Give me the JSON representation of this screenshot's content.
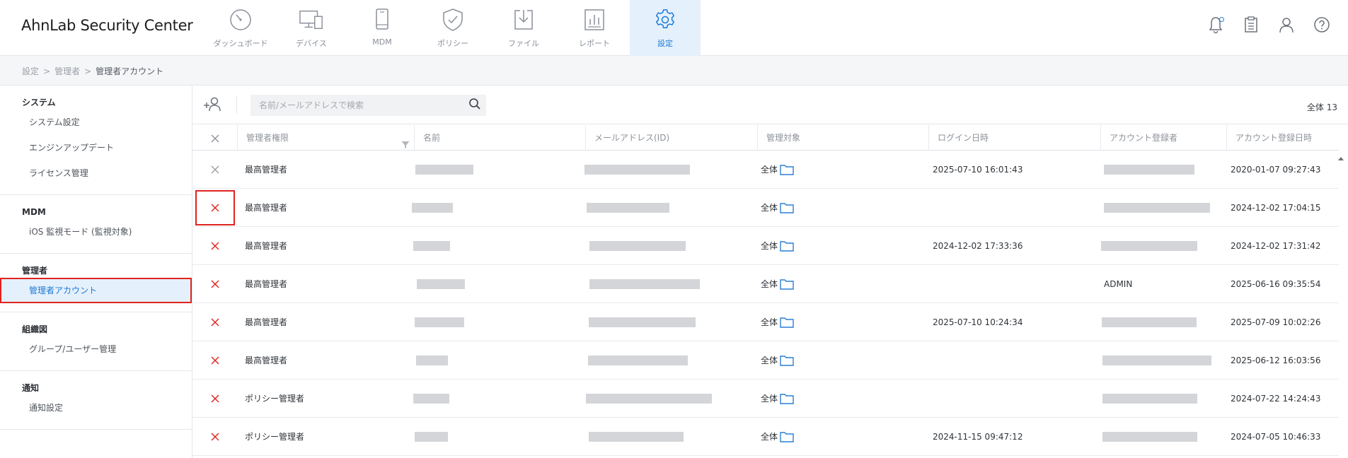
{
  "app": {
    "title": "AhnLab Security Center"
  },
  "nav": [
    {
      "id": "dashboard",
      "label": "ダッシュボード",
      "icon": "dashboard-icon",
      "active": false
    },
    {
      "id": "device",
      "label": "デバイス",
      "icon": "device-icon",
      "active": false
    },
    {
      "id": "mdm",
      "label": "MDM",
      "icon": "mobile-icon",
      "active": false
    },
    {
      "id": "policy",
      "label": "ポリシー",
      "icon": "shield-icon",
      "active": false
    },
    {
      "id": "file",
      "label": "ファイル",
      "icon": "download-icon",
      "active": false
    },
    {
      "id": "report",
      "label": "レポート",
      "icon": "report-icon",
      "active": false
    },
    {
      "id": "settings",
      "label": "設定",
      "icon": "gear-icon",
      "active": true
    }
  ],
  "top_actions": [
    "bell-icon",
    "clipboard-icon",
    "user-icon",
    "help-icon"
  ],
  "breadcrumb": {
    "items": [
      "設定",
      "管理者"
    ],
    "current": "管理者アカウント",
    "separator": ">"
  },
  "sidebar": {
    "groups": [
      {
        "title": "システム",
        "items": [
          {
            "label": "システム設定"
          },
          {
            "label": "エンジンアップデート"
          },
          {
            "label": "ライセンス管理"
          }
        ]
      },
      {
        "title": "MDM",
        "items": [
          {
            "label": "iOS 監視モード (監視対象)"
          }
        ]
      },
      {
        "title": "管理者",
        "items": [
          {
            "label": "管理者アカウント",
            "active": true
          }
        ]
      },
      {
        "title": "組織図",
        "items": [
          {
            "label": "グループ/ユーザー管理"
          }
        ]
      },
      {
        "title": "通知",
        "items": [
          {
            "label": "通知設定"
          }
        ]
      }
    ]
  },
  "toolbar": {
    "search_placeholder": "名前/メールアドレスで検索",
    "total_label": "全体 13"
  },
  "table": {
    "columns": [
      "×",
      "管理者権限",
      "名前",
      "メールアドレス(ID)",
      "管理対象",
      "ログイン日時",
      "アカウント登録者",
      "アカウント登録日時"
    ],
    "rows": [
      {
        "delete_color": "#9aa0a6",
        "role": "最高管理者",
        "target": "全体",
        "login": "2025-07-10 16:01:43",
        "registrar": "",
        "registered": "2020-01-07 09:27:43"
      },
      {
        "delete_color": "#e0231f",
        "highlight": true,
        "role": "最高管理者",
        "target": "全体",
        "login": "",
        "registrar": "",
        "registered": "2024-12-02 17:04:15"
      },
      {
        "delete_color": "#e0231f",
        "role": "最高管理者",
        "target": "全体",
        "login": "2024-12-02 17:33:36",
        "registrar": "",
        "registered": "2024-12-02 17:31:42"
      },
      {
        "delete_color": "#e0231f",
        "role": "最高管理者",
        "target": "全体",
        "login": "",
        "registrar": "ADMIN",
        "registered": "2025-06-16 09:35:54"
      },
      {
        "delete_color": "#e0231f",
        "role": "最高管理者",
        "target": "全体",
        "login": "2025-07-10 10:24:34",
        "registrar": "",
        "registered": "2025-07-09 10:02:26"
      },
      {
        "delete_color": "#e0231f",
        "role": "最高管理者",
        "target": "全体",
        "login": "",
        "registrar": "",
        "registered": "2025-06-12 16:03:56"
      },
      {
        "delete_color": "#e0231f",
        "role": "ポリシー管理者",
        "target": "全体",
        "login": "",
        "registrar": "",
        "registered": "2024-07-22 14:24:43"
      },
      {
        "delete_color": "#e0231f",
        "role": "ポリシー管理者",
        "target": "全体",
        "login": "2024-11-15 09:47:12",
        "registrar": "",
        "registered": "2024-07-05 10:46:33"
      }
    ]
  },
  "colors": {
    "accent": "#1b79d8",
    "active_bg": "#e4f0fb",
    "highlight": "#e0231f",
    "redacted": "#d3d5d8"
  }
}
